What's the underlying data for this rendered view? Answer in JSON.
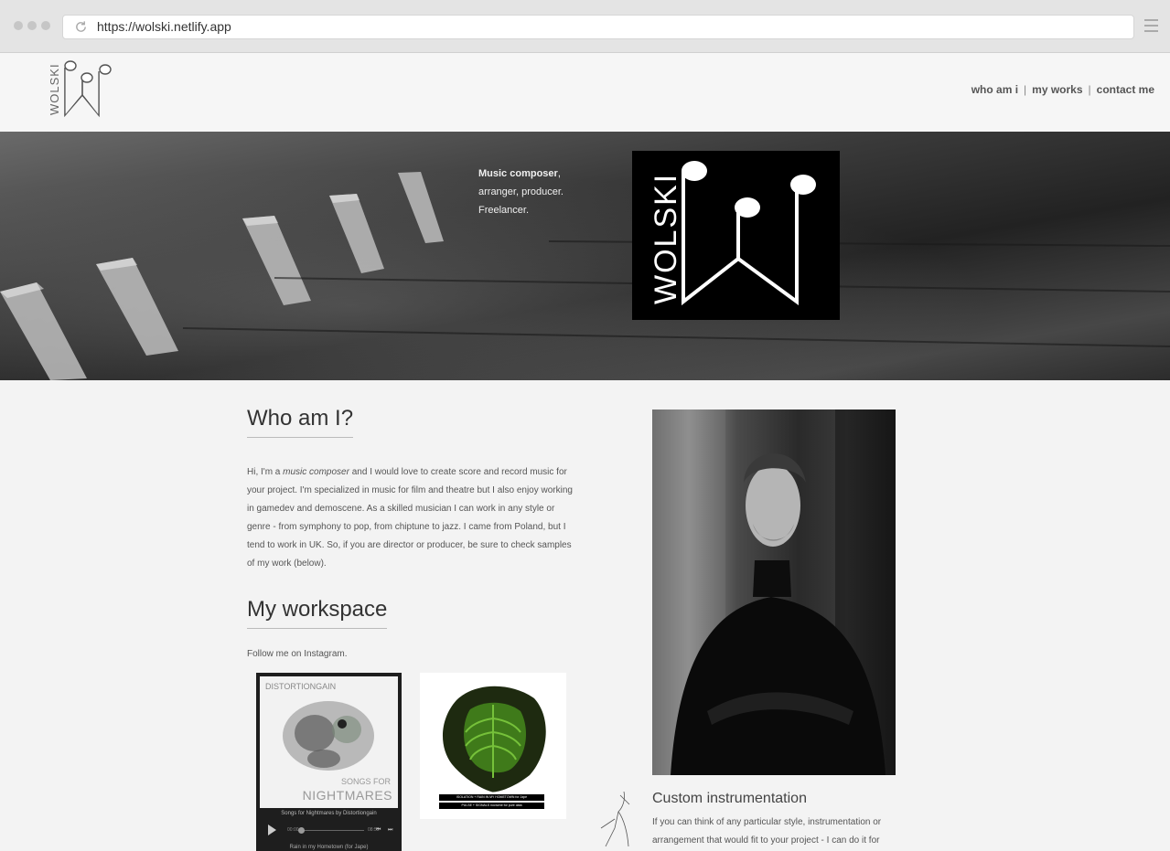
{
  "browser": {
    "url": "https://wolski.netlify.app"
  },
  "site": {
    "logo_text": "WOLSKI",
    "nav": [
      {
        "label": "who am i"
      },
      {
        "label": "my works"
      },
      {
        "label": "contact me"
      }
    ],
    "nav_separator": "|"
  },
  "hero": {
    "tagline_bold": "Music composer",
    "tagline_line1_rest": ",",
    "tagline_line2": "arranger, producer.",
    "tagline_line3": "Freelancer.",
    "logo_text": "WOLSKI"
  },
  "about": {
    "heading": "Who am I?",
    "bio_start": "Hi, I'm a ",
    "bio_emphasis": "music composer",
    "bio_rest": " and I would love to create score and record music for your project. I'm specialized in music for film and theatre but I also enjoy working in gamedev and demoscene. As a skilled musician I can work in any style or genre - from symphony to pop, from chiptune to jazz. I came from Poland, but I tend to work in UK. So, if you are director or producer, be sure to check samples of my work (below)."
  },
  "workspace": {
    "heading": "My workspace",
    "follow_text": "Follow me on Instagram."
  },
  "player": {
    "artist": "DISTORTIONGAIN",
    "album_line1": "SONGS FOR",
    "album_line2": "NIGHTMARES",
    "caption": "Songs for Nightmares by Distortiongain",
    "time_current": "00:00",
    "time_total": "08:55",
    "track": "Rain in my Hometown (for Jape)"
  },
  "cover2": {
    "line1": "ISOLATION + RAIN IN MY HOMETOWN for Jape",
    "line2": "PULSE + SIGNALS nocturne for pure data"
  },
  "instrumentation": {
    "title": "Custom instrumentation",
    "text": "If you can think of any particular style, instrumentation or arrangement that would fit to your project - I can do it for"
  }
}
